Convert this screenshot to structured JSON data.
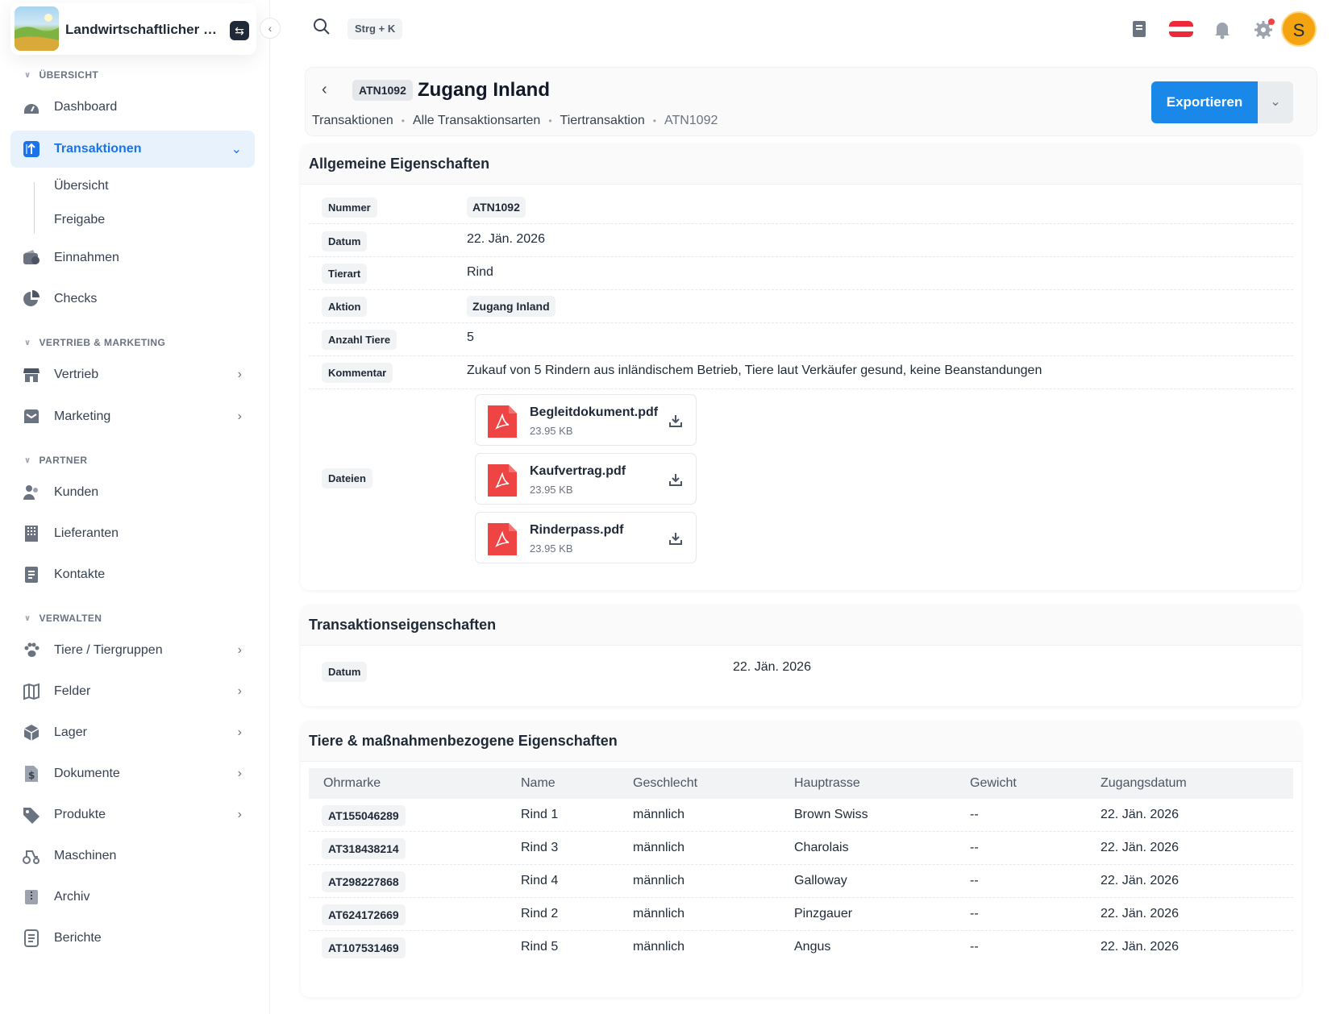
{
  "brand": {
    "name": "Landwirtschaftlicher B..."
  },
  "topbar": {
    "shortcut": "Strg + K",
    "avatar_letter": "S",
    "accent": "#1a88e8"
  },
  "sidebar": {
    "sections": {
      "overview": "ÜBERSICHT",
      "sales": "VERTRIEB & MARKETING",
      "partner": "PARTNER",
      "manage": "VERWALTEN"
    },
    "items": {
      "dashboard": "Dashboard",
      "transactions": "Transaktionen",
      "sub_overview": "Übersicht",
      "sub_release": "Freigabe",
      "income": "Einnahmen",
      "checks": "Checks",
      "sales": "Vertrieb",
      "marketing": "Marketing",
      "customers": "Kunden",
      "suppliers": "Lieferanten",
      "contacts": "Kontakte",
      "animals": "Tiere / Tiergruppen",
      "fields": "Felder",
      "storage": "Lager",
      "documents": "Dokumente",
      "products": "Produkte",
      "machines": "Maschinen",
      "archive": "Archiv",
      "reports": "Berichte"
    }
  },
  "header": {
    "id": "ATN1092",
    "title": "Zugang Inland",
    "breadcrumb": [
      "Transaktionen",
      "Alle Transaktionsarten",
      "Tiertransaktion",
      "ATN1092"
    ],
    "export_label": "Exportieren"
  },
  "general": {
    "title": "Allgemeine Eigenschaften",
    "rows": {
      "number": {
        "label": "Nummer",
        "value": "ATN1092"
      },
      "date": {
        "label": "Datum",
        "value": "22. Jän. 2026"
      },
      "species": {
        "label": "Tierart",
        "value": "Rind"
      },
      "action": {
        "label": "Aktion",
        "value": "Zugang Inland"
      },
      "count": {
        "label": "Anzahl Tiere",
        "value": "5"
      },
      "comment": {
        "label": "Kommentar",
        "value": "Zukauf von 5 Rindern aus inländischem Betrieb, Tiere laut Verkäufer gesund, keine Beanstandungen"
      },
      "files": {
        "label": "Dateien"
      }
    },
    "files": [
      {
        "name": "Begleitdokument.pdf",
        "size": "23.95 KB"
      },
      {
        "name": "Kaufvertrag.pdf",
        "size": "23.95 KB"
      },
      {
        "name": "Rinderpass.pdf",
        "size": "23.95 KB"
      }
    ]
  },
  "transaction": {
    "title": "Transaktionseigenschaften",
    "date_label": "Datum",
    "date_value": "22. Jän. 2026"
  },
  "animals": {
    "title": "Tiere & maßnahmenbezogene Eigenschaften",
    "columns": [
      "Ohrmarke",
      "Name",
      "Geschlecht",
      "Hauptrasse",
      "Gewicht",
      "Zugangsdatum"
    ],
    "rows": [
      [
        "AT155046289",
        "Rind 1",
        "männlich",
        "Brown Swiss",
        "--",
        "22. Jän. 2026"
      ],
      [
        "AT318438214",
        "Rind 3",
        "männlich",
        "Charolais",
        "--",
        "22. Jän. 2026"
      ],
      [
        "AT298227868",
        "Rind 4",
        "männlich",
        "Galloway",
        "--",
        "22. Jän. 2026"
      ],
      [
        "AT624172669",
        "Rind 2",
        "männlich",
        "Pinzgauer",
        "--",
        "22. Jän. 2026"
      ],
      [
        "AT107531469",
        "Rind 5",
        "männlich",
        "Angus",
        "--",
        "22. Jän. 2026"
      ]
    ]
  }
}
